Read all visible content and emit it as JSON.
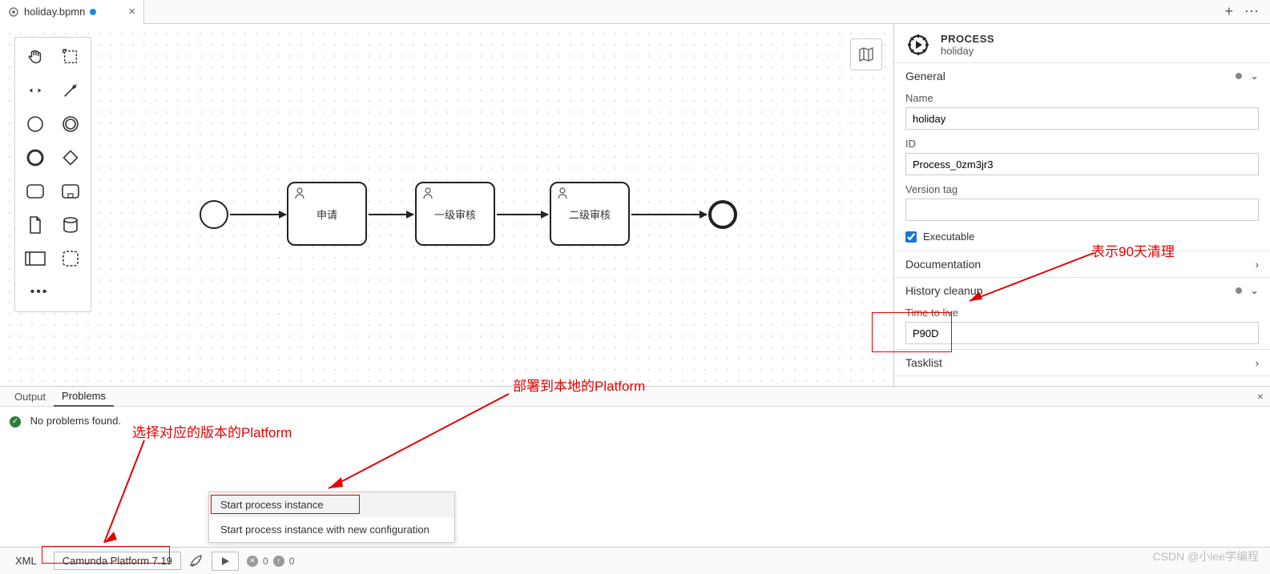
{
  "tab": {
    "filename": "holiday.bpmn"
  },
  "diagram": {
    "tasks": [
      "申请",
      "一级审核",
      "二级审核"
    ]
  },
  "props": {
    "header_type": "PROCESS",
    "header_name": "holiday",
    "sections": {
      "general": "General",
      "documentation": "Documentation",
      "history_cleanup": "History cleanup",
      "tasklist": "Tasklist"
    },
    "fields": {
      "name_label": "Name",
      "name_value": "holiday",
      "id_label": "ID",
      "id_value": "Process_0zm3jr3",
      "version_tag_label": "Version tag",
      "version_tag_value": "",
      "executable_label": "Executable",
      "ttl_label": "Time to live",
      "ttl_value": "P90D"
    }
  },
  "output": {
    "tab_output": "Output",
    "tab_problems": "Problems",
    "message": "No problems found."
  },
  "annotations": {
    "ttl_note": "表示90天清理",
    "platform_note": "选择对应的版本的Platform",
    "deploy_note": "部署到本地的Platform"
  },
  "context_menu": {
    "item1": "Start process instance",
    "item2": "Start process instance with new configuration"
  },
  "status": {
    "xml": "XML",
    "platform": "Camunda Platform 7.19",
    "err_count": "0",
    "warn_count": "0"
  },
  "watermark": "CSDN @小lee学编程"
}
